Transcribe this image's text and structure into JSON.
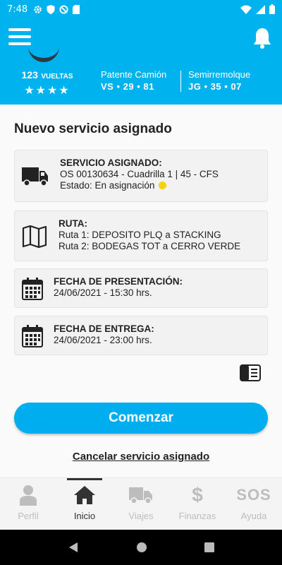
{
  "status_bar": {
    "time": "7:48"
  },
  "header": {
    "vueltas_count": "123",
    "vueltas_unit": "VUELTAS",
    "stars": "★★★★",
    "patente_label": "Patente Camión",
    "patente_value": "VS • 29 • 81",
    "semi_label": "Semirremolque",
    "semi_value": "JG • 35 • 07"
  },
  "main": {
    "title": "Nuevo servicio asignado",
    "servicio": {
      "label": "SERVICIO ASIGNADO:",
      "line1": "OS 00130634 - Cuadrilla 1 | 45 - CFS",
      "line2": "Estado: En asignación"
    },
    "ruta": {
      "label": "RUTA:",
      "line1": "Ruta 1: DEPOSITO PLQ a STACKING",
      "line2": "Ruta 2: BODEGAS TOT a CERRO VERDE"
    },
    "presentacion": {
      "label": "FECHA DE PRESENTACIÓN:",
      "line1": "24/06/2021 - 15:30 hrs."
    },
    "entrega": {
      "label": "FECHA DE ENTREGA:",
      "line1": "24/06/2021 - 23:00 hrs."
    },
    "start_button": "Comenzar",
    "cancel_link": "Cancelar servicio asignado"
  },
  "bottom_nav": [
    {
      "label": "Perfil",
      "icon": "person-icon",
      "active": false
    },
    {
      "label": "Inicio",
      "icon": "home-icon",
      "active": true
    },
    {
      "label": "Viajes",
      "icon": "truck-icon",
      "active": false
    },
    {
      "label": "Finanzas",
      "icon": "dollar-icon",
      "active": false
    },
    {
      "label": "Ayuda",
      "icon": "sos-icon",
      "active": false
    }
  ],
  "nav_icon_text": {
    "dollar": "$",
    "sos": "SOS"
  },
  "colors": {
    "accent": "#00b2ee",
    "status_pending": "#f5d20c"
  }
}
